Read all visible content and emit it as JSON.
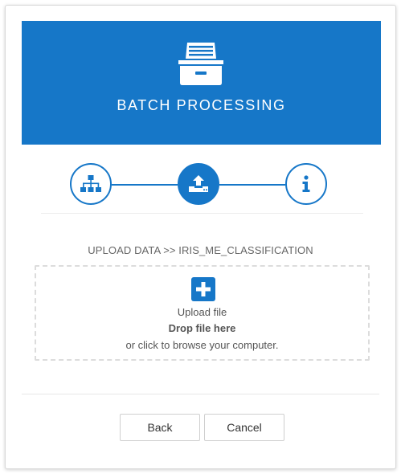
{
  "banner": {
    "title": "BATCH PROCESSING",
    "icon": "file-drawer-icon",
    "color": "#1677c8"
  },
  "stepper": {
    "steps": [
      {
        "icon": "hierarchy-icon",
        "state": "inactive"
      },
      {
        "icon": "upload-tray-icon",
        "state": "active"
      },
      {
        "icon": "info-icon",
        "state": "inactive"
      }
    ]
  },
  "upload": {
    "path_label": "UPLOAD DATA >> IRIS_ME_CLASSIFICATION",
    "icon": "plus-square-icon",
    "title": "Upload file",
    "drop_text": "Drop file here",
    "browse_text": "or click to browse your computer."
  },
  "actions": {
    "back_label": "Back",
    "cancel_label": "Cancel"
  }
}
